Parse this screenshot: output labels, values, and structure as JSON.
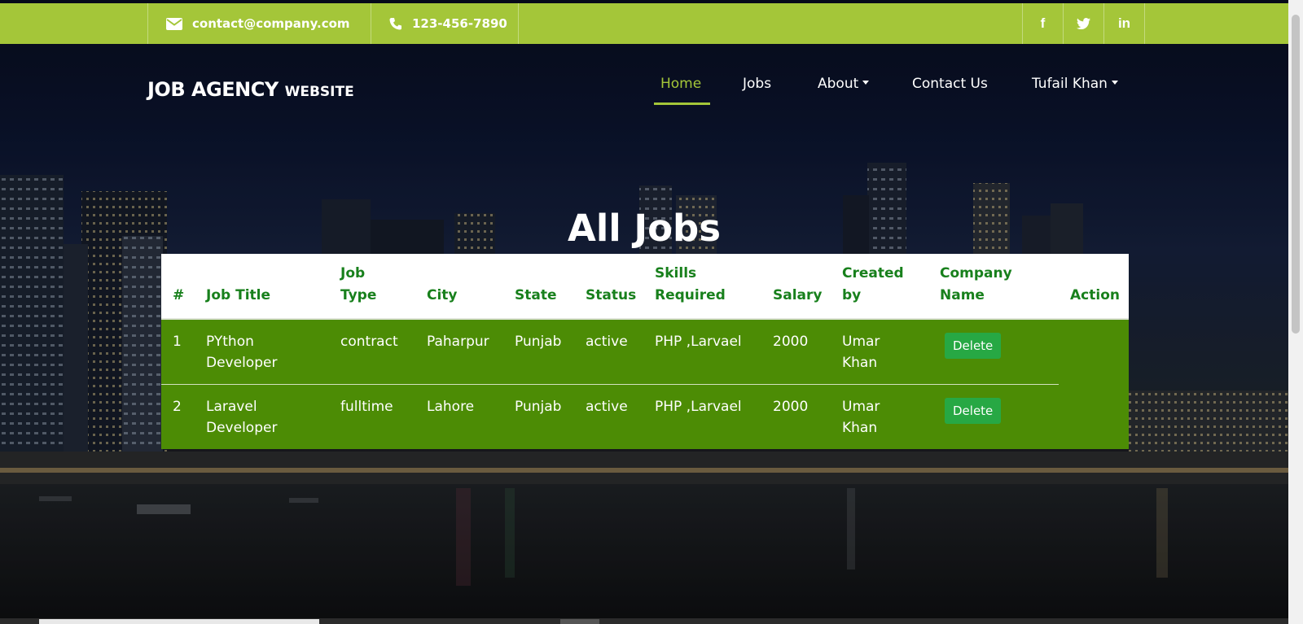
{
  "topbar": {
    "email": "contact@company.com",
    "phone": "123-456-7890",
    "social": [
      {
        "label": "f",
        "icon": "facebook-icon"
      },
      {
        "label": "twitter",
        "icon": "twitter-icon"
      },
      {
        "label": "in",
        "icon": "linkedin-icon"
      }
    ],
    "color": "#a4c639"
  },
  "brand": {
    "main": "JOB AGENCY",
    "sub": "WEBSITE"
  },
  "nav": {
    "items": [
      {
        "label": "Home",
        "active": true
      },
      {
        "label": "Jobs",
        "active": false
      },
      {
        "label": "About",
        "dropdown": true
      },
      {
        "label": "Contact Us",
        "active": false
      },
      {
        "label": "Tufail Khan",
        "dropdown": true
      }
    ],
    "active_color": "#a4c639"
  },
  "page": {
    "title": "All Jobs"
  },
  "table": {
    "columns": [
      {
        "line1": "#",
        "line2": ""
      },
      {
        "line1": "Job Title",
        "line2": ""
      },
      {
        "line1": "Job",
        "line2": "Type"
      },
      {
        "line1": "City",
        "line2": ""
      },
      {
        "line1": "State",
        "line2": ""
      },
      {
        "line1": "Status",
        "line2": ""
      },
      {
        "line1": "Skills",
        "line2": "Required"
      },
      {
        "line1": "Salary",
        "line2": ""
      },
      {
        "line1": "Created",
        "line2": "by"
      },
      {
        "line1": "Company",
        "line2": "Name"
      },
      {
        "line1": "Action",
        "line2": ""
      }
    ],
    "rows": [
      {
        "id": "1",
        "title_1": "PYthon",
        "title_2": "Developer",
        "type": "contract",
        "city": "Paharpur",
        "state": "Punjab",
        "status": "active",
        "skills": "PHP ,Larvael",
        "salary": "2000",
        "created_1": "Umar",
        "created_2": "Khan",
        "company_action": "Delete"
      },
      {
        "id": "2",
        "title_1": "Laravel",
        "title_2": "Developer",
        "type": "fulltime",
        "city": "Lahore",
        "state": "Punjab",
        "status": "active",
        "skills": "PHP ,Larvael",
        "salary": "2000",
        "created_1": "Umar",
        "created_2": "Khan",
        "company_action": "Delete"
      }
    ],
    "header_color": "#18801c",
    "body_color": "#4c8c05",
    "button_color": "#27a844"
  }
}
